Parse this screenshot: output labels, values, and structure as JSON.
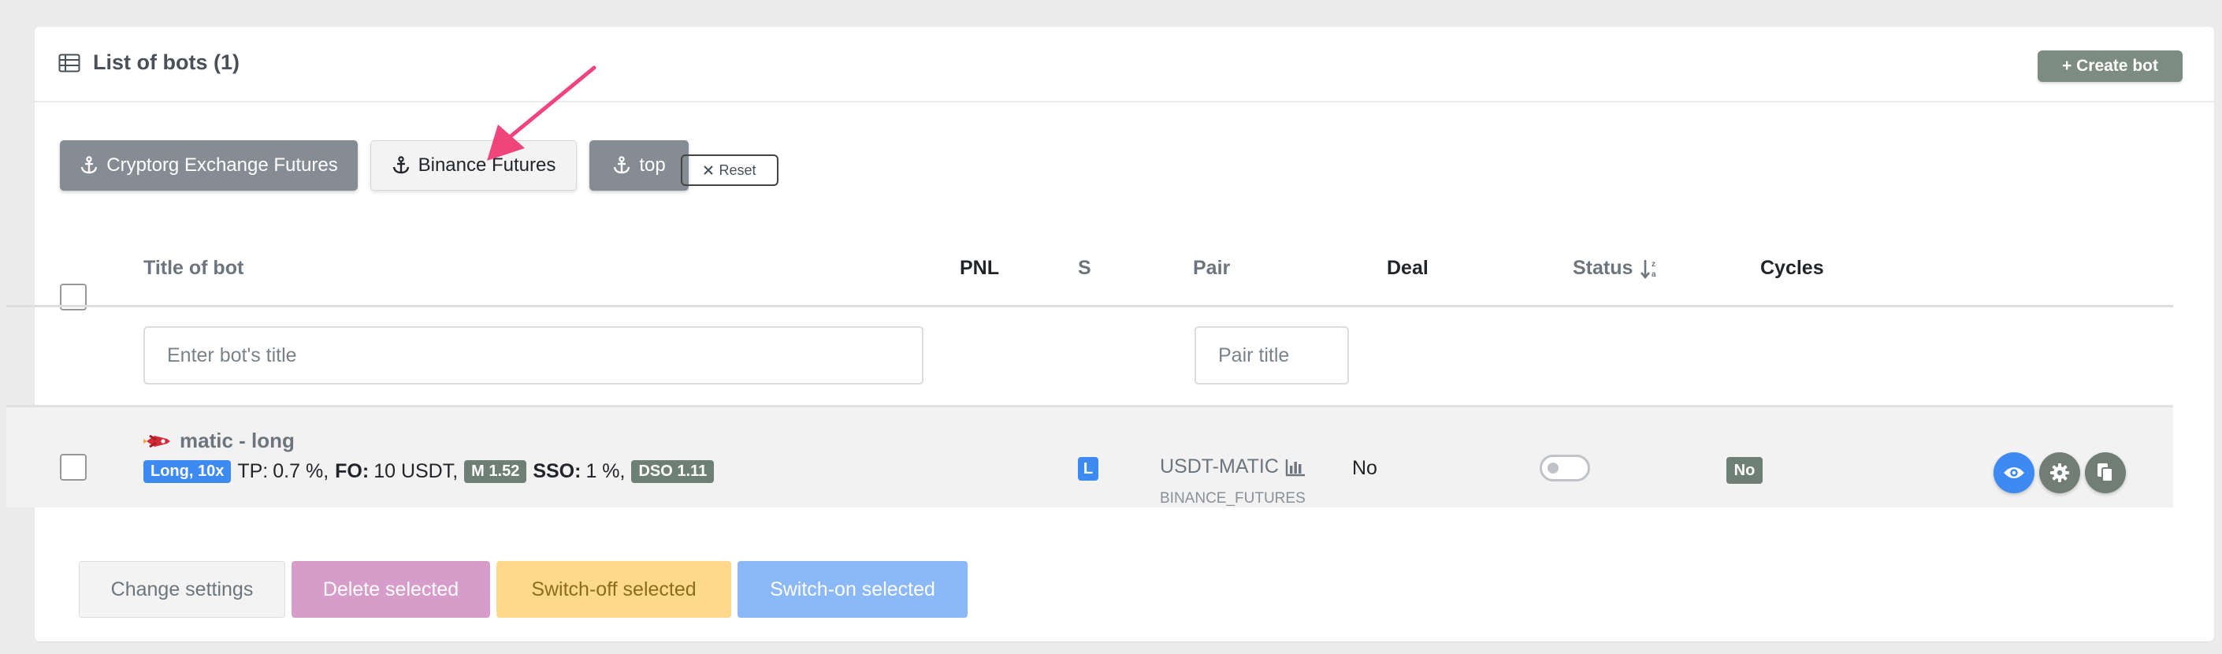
{
  "header": {
    "title": "List of bots (1)",
    "create_label": "+ Create bot"
  },
  "filters": [
    {
      "label": "Cryptorg Exchange Futures",
      "style": "dark"
    },
    {
      "label": "Binance Futures",
      "style": "light"
    },
    {
      "label": "top",
      "style": "dark"
    }
  ],
  "reset_label": "Reset",
  "table": {
    "headers": {
      "title": "Title of bot",
      "pnl": "PNL",
      "s": "S",
      "pair": "Pair",
      "deal": "Deal",
      "status": "Status",
      "cycles": "Cycles"
    },
    "search": {
      "title_placeholder": "Enter bot's title",
      "pair_placeholder": "Pair title"
    }
  },
  "bot": {
    "name": "matic - long",
    "position_badge": "Long, 10x",
    "tp_label": "TP:",
    "tp_value": "0.7 %,",
    "fo_label": "FO:",
    "fo_value": "10 USDT,",
    "m_badge": "M 1.52",
    "sso_label": "SSO:",
    "sso_value": "1 %,",
    "dso_badge": "DSO 1.11",
    "side": "L",
    "pair": "USDT-MATIC",
    "exchange": "BINANCE_FUTURES",
    "deal": "No",
    "status_enabled": false,
    "cycles": "No"
  },
  "footer": {
    "change": "Change settings",
    "delete": "Delete selected",
    "off": "Switch-off selected",
    "on": "Switch-on selected"
  },
  "colors": {
    "primary": "#3d8bf2",
    "secondary": "#858c93",
    "danger_light": "#d69dcb",
    "warning_light": "#fdd98b",
    "primary_light": "#8bb8f7",
    "annotation_arrow": "#f0457c"
  }
}
